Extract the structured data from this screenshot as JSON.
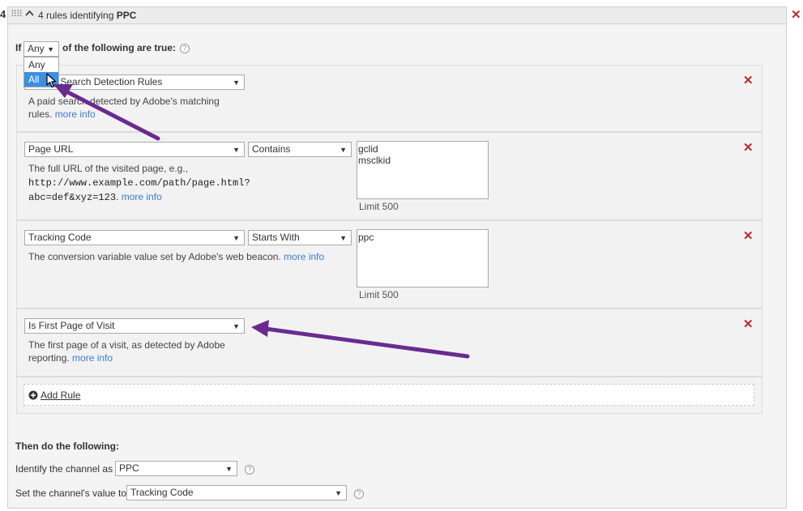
{
  "header": {
    "row_number": "4",
    "title_prefix": "4 rules identifying ",
    "title_bold": "PPC"
  },
  "condition": {
    "if_label": "If",
    "match_value": "Any",
    "suffix": "of the following are true:",
    "dropdown_options": [
      "Any",
      "All"
    ],
    "highlighted_option": "All"
  },
  "rules": [
    {
      "field": "is Paid Search Detection Rules",
      "description": "A paid search detected by Adobe's matching rules.",
      "desc_line1": "A paid search detected by Adobe's matching",
      "desc_line2": "rules.",
      "more_info": "more info"
    },
    {
      "field": "Page URL",
      "operator": "Contains",
      "desc_line1": "The full URL of the visited page, e.g.,",
      "desc_mono1": "http://www.example.com/path/page.html?",
      "desc_mono2": "abc=def&xyz=123",
      "desc_tail": ".",
      "more_info": "more info",
      "values": "gclid\nmsclkid",
      "limit": "Limit 500"
    },
    {
      "field": "Tracking Code",
      "operator": "Starts With",
      "desc_line1": "The conversion variable value set by Adobe's web beacon.",
      "more_info": "more info",
      "values": "ppc",
      "limit": "Limit 500"
    },
    {
      "field": "Is First Page of Visit",
      "desc_line1": "The first page of a visit, as detected by Adobe",
      "desc_line2": "reporting.",
      "more_info": "more info"
    }
  ],
  "add_rule_label": "Add Rule",
  "then": {
    "heading": "Then do the following:",
    "identify_label": "Identify the channel as",
    "identify_value": "PPC",
    "set_value_label": "Set the channel's value to",
    "set_value_value": "Tracking Code"
  },
  "icons": {
    "close": "close-x-icon",
    "help": "help-question-icon",
    "collapse": "chevron-up-icon",
    "drag": "drag-grip-icon",
    "add": "plus-circle-icon",
    "cursor": "mouse-pointer-icon"
  },
  "colors": {
    "close_red": "#c0282d",
    "link_blue": "#3f7ad5",
    "highlight_blue": "#3d8fe0",
    "annotation_purple": "#6a2b8f"
  }
}
